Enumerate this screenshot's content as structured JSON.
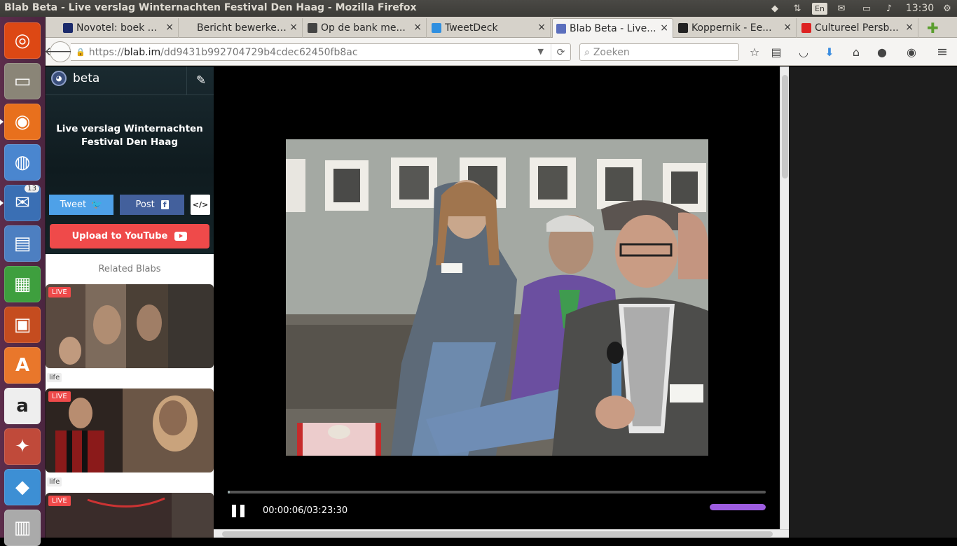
{
  "window": {
    "title": "Blab Beta - Live verslag Winternachten Festival Den Haag - Mozilla Firefox"
  },
  "tray": {
    "lang": "En",
    "clock": "13:30"
  },
  "launcher": {
    "items": [
      {
        "name": "ubuntu-dash",
        "color": "#dd4814"
      },
      {
        "name": "files",
        "color": "#8a8577"
      },
      {
        "name": "firefox",
        "color": "#e8701d"
      },
      {
        "name": "chromium",
        "color": "#4a86cf"
      },
      {
        "name": "thunderbird",
        "color": "#3a6fb4",
        "badge": "13"
      },
      {
        "name": "libreoffice-impress",
        "color": "#4d7fc1"
      },
      {
        "name": "libreoffice-calc",
        "color": "#3e9f3e"
      },
      {
        "name": "libreoffice-writer-template",
        "color": "#c54c1f"
      },
      {
        "name": "software-center",
        "color": "#e9772b"
      },
      {
        "name": "amazon",
        "color": "#eeeeee"
      },
      {
        "name": "system-settings",
        "color": "#c04a3a"
      },
      {
        "name": "dropbox",
        "color": "#3d8fd4"
      },
      {
        "name": "workspaces",
        "color": "#aaaaaa"
      }
    ]
  },
  "tabs": [
    {
      "label": "Novotel: boek ...",
      "favcolor": "#1b2a6b"
    },
    {
      "label": "Bericht bewerken ‹...",
      "favcolor": "#d6d2ca"
    },
    {
      "label": "Op de bank me...",
      "favcolor": "#444444"
    },
    {
      "label": "TweetDeck",
      "favcolor": "#2f8fe0"
    },
    {
      "label": "Blab Beta - Live...",
      "favcolor": "#5b6fbd",
      "active": true
    },
    {
      "label": "Koppernik - Ee...",
      "favcolor": "#222222"
    },
    {
      "label": "Cultureel Persb...",
      "favcolor": "#dd2222"
    }
  ],
  "nav": {
    "url_scheme": "https://",
    "url_host": "blab.im",
    "url_path": "/dd9431b992704729b4cdec62450fb8ac",
    "search_placeholder": "Zoeken"
  },
  "sidebar": {
    "brand": "beta",
    "blab_title": "Live verslag Winternachten Festival Den Haag",
    "tweet_label": "Tweet",
    "post_label": "Post",
    "embed_label": "</>",
    "youtube_label": "Upload to YouTube",
    "related_title": "Related Blabs",
    "related": [
      {
        "badge": "LIVE",
        "tag": "life"
      },
      {
        "badge": "LIVE",
        "tag": "life"
      },
      {
        "badge": "LIVE"
      }
    ]
  },
  "player": {
    "time": "00:00:06/03:23:30",
    "progress": 0.0005,
    "volume": 1.0
  }
}
